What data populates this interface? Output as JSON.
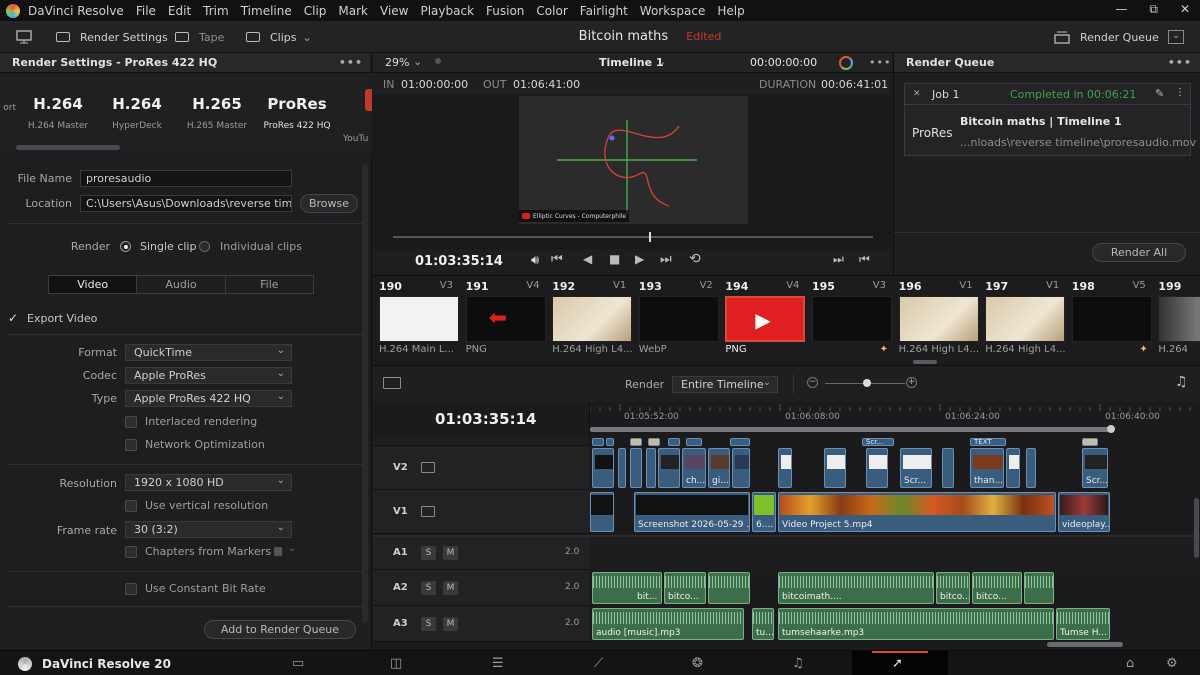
{
  "menubar": {
    "app_name": "DaVinci Resolve",
    "items": [
      "File",
      "Edit",
      "Trim",
      "Timeline",
      "Clip",
      "Mark",
      "View",
      "Playback",
      "Fusion",
      "Color",
      "Fairlight",
      "Workspace",
      "Help"
    ],
    "window_controls": [
      "—",
      "⧉",
      "✕"
    ]
  },
  "toolbar": {
    "render_settings": "Render Settings",
    "tape": "Tape",
    "clips": "Clips",
    "project_title": "Bitcoin maths",
    "edited": "Edited",
    "render_queue": "Render Queue"
  },
  "render_settings": {
    "panel_title": "Render Settings - ProRes 422 HQ",
    "presets": [
      {
        "big": "",
        "small": "ort"
      },
      {
        "big": "H.264",
        "small": "H.264 Master"
      },
      {
        "big": "H.264",
        "small": "HyperDeck"
      },
      {
        "big": "H.265",
        "small": "H.265 Master"
      },
      {
        "big": "ProRes",
        "small": "ProRes 422 HQ"
      },
      {
        "big": "",
        "small": "YouTu"
      }
    ],
    "file_name_label": "File Name",
    "file_name": "proresaudio",
    "location_label": "Location",
    "location": "C:\\Users\\Asus\\Downloads\\reverse timelir",
    "browse": "Browse",
    "render_label": "Render",
    "single_clip": "Single clip",
    "individual_clips": "Individual clips",
    "tabs": [
      "Video",
      "Audio",
      "File"
    ],
    "export_video": "Export Video",
    "format_label": "Format",
    "format": "QuickTime",
    "codec_label": "Codec",
    "codec": "Apple ProRes",
    "type_label": "Type",
    "type": "Apple ProRes 422 HQ",
    "interlaced": "Interlaced rendering",
    "network_opt": "Network Optimization",
    "resolution_label": "Resolution",
    "resolution": "1920 x 1080 HD",
    "vertical_res": "Use vertical resolution",
    "frame_rate_label": "Frame rate",
    "frame_rate": "30 (3:2)",
    "chapters": "Chapters from Markers",
    "constant_bitrate": "Use Constant Bit Rate",
    "add_to_queue": "Add to Render Queue"
  },
  "viewer": {
    "zoom": "29%",
    "timeline_name": "Timeline 1",
    "timecode_top": "00:00:00:00",
    "in_label": "IN",
    "in_tc": "01:00:00:00",
    "out_label": "OUT",
    "out_tc": "01:06:41:00",
    "duration_label": "DURATION",
    "duration_tc": "00:06:41:01",
    "current_tc": "01:03:35:14",
    "video_caption": "Elliptic Curves - Computerphile"
  },
  "render_queue": {
    "title": "Render Queue",
    "job_name": "Job 1",
    "job_status": "Completed in 00:06:21",
    "job_codec": "ProRes",
    "job_title": "Bitcoin maths | Timeline 1",
    "job_path": "...nloads\\reverse timeline\\proresaudio.mov",
    "render_all": "Render All"
  },
  "clips_strip": [
    {
      "num": "190",
      "track": "V3",
      "format": "H.264 Main L...",
      "thumb": "graph",
      "spark": false,
      "selected": false
    },
    {
      "num": "191",
      "track": "V4",
      "format": "PNG",
      "thumb": "arrow",
      "spark": false,
      "selected": false
    },
    {
      "num": "192",
      "track": "V1",
      "format": "H.264 High L4...",
      "thumb": "paper",
      "spark": false,
      "selected": false
    },
    {
      "num": "193",
      "track": "V2",
      "format": "WebP",
      "thumb": "black",
      "spark": false,
      "selected": false
    },
    {
      "num": "194",
      "track": "V4",
      "format": "PNG",
      "thumb": "youtube",
      "spark": false,
      "selected": true
    },
    {
      "num": "195",
      "track": "V3",
      "format": "",
      "thumb": "black",
      "spark": true,
      "selected": false
    },
    {
      "num": "196",
      "track": "V1",
      "format": "H.264 High L4...",
      "thumb": "paper",
      "spark": false,
      "selected": false
    },
    {
      "num": "197",
      "track": "V1",
      "format": "H.264 High L4...",
      "thumb": "paper",
      "spark": false,
      "selected": false
    },
    {
      "num": "198",
      "track": "V5",
      "format": "",
      "thumb": "black",
      "spark": true,
      "selected": false
    },
    {
      "num": "199",
      "track": "",
      "format": "H.264",
      "thumb": "room",
      "spark": false,
      "selected": false
    }
  ],
  "timeline": {
    "render_label": "Render",
    "render_mode": "Entire Timeline",
    "timecode": "01:03:35:14",
    "ruler": [
      "01:05:52:00",
      "01:06:08:00",
      "01:06:24:00",
      "01:06:40:00"
    ],
    "tracks": [
      {
        "name": "V2",
        "kind": "video"
      },
      {
        "name": "V1",
        "kind": "video"
      },
      {
        "name": "A1",
        "kind": "audio",
        "level": "2.0"
      },
      {
        "name": "A2",
        "kind": "audio",
        "level": "2.0"
      },
      {
        "name": "A3",
        "kind": "audio",
        "level": "2.0"
      }
    ],
    "v2_labels": [
      "ch...",
      "gi...",
      "Scr...",
      "than...",
      "Scr..."
    ],
    "v1_labels": [
      "Screenshot 2026-05-29 ...",
      "6....",
      "Video Project 5.mp4",
      "videoplay..."
    ],
    "a2_labels": [
      "bit...",
      "bitco...",
      "bitcoimath....",
      "bitco...",
      "bitco..."
    ],
    "a3_labels": [
      "audio [music].mp3",
      "tu...",
      "tumsehaarke.mp3",
      "Tumse H..."
    ],
    "top_labels": [
      "Scr...",
      "TEXT"
    ]
  },
  "bottombar": {
    "app_name": "DaVinci Resolve 20"
  },
  "colors": {
    "accent_red": "#d94a3a",
    "video_clip": "#3b5d7d",
    "audio_clip": "#3d6e4c",
    "completed_green": "#3fa34d"
  }
}
